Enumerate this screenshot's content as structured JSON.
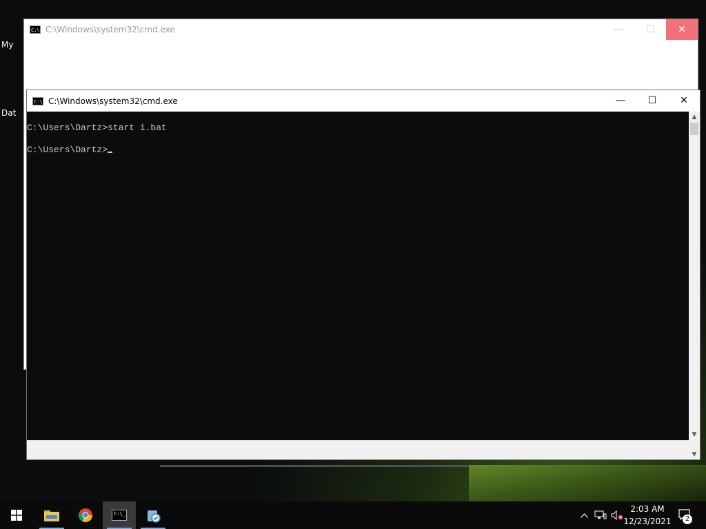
{
  "desktop": {
    "icons": [
      {
        "label": "My"
      },
      {
        "label": "Dat"
      }
    ]
  },
  "back_window": {
    "title": "C:\\Windows\\system32\\cmd.exe",
    "minimize": "—",
    "maximize": "☐",
    "close": "✕"
  },
  "front_window": {
    "title": "C:\\Windows\\system32\\cmd.exe",
    "minimize": "—",
    "maximize": "☐",
    "close": "✕",
    "console_lines": [
      "C:\\Users\\Dartz>start i.bat",
      "C:\\Users\\Dartz>"
    ]
  },
  "taskbar": {
    "apps": [
      {
        "name": "start",
        "icon": "windows-logo-icon"
      },
      {
        "name": "file-explorer",
        "icon": "folder-icon"
      },
      {
        "name": "chrome",
        "icon": "chrome-icon"
      },
      {
        "name": "command-prompt",
        "icon": "cmd-icon",
        "active": true
      },
      {
        "name": "recycle-app",
        "icon": "recycle-icon"
      }
    ],
    "time": "2:03 AM",
    "date": "12/23/2021",
    "notification_count": "2"
  }
}
